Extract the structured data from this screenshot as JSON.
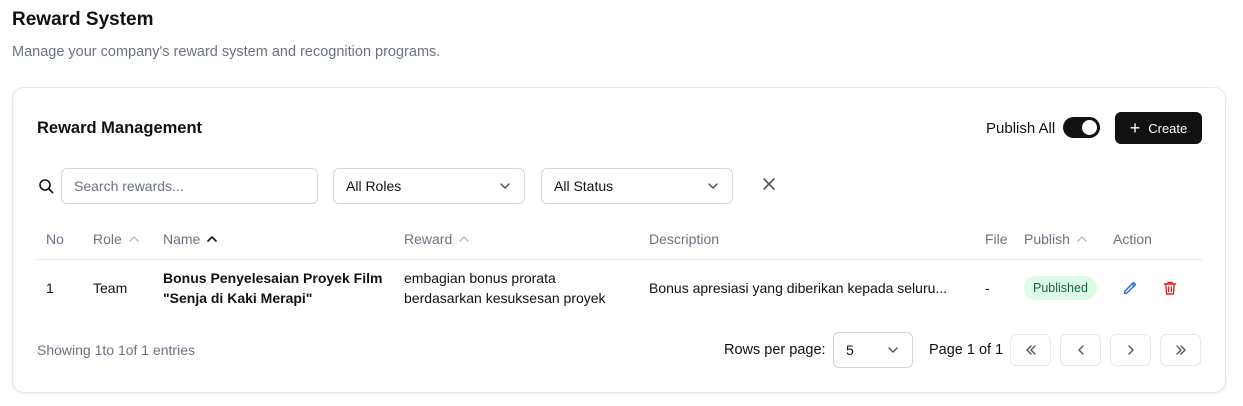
{
  "page": {
    "title": "Reward System",
    "subtitle": "Manage your company's reward system and recognition programs."
  },
  "card": {
    "title": "Reward Management",
    "publish_all_label": "Publish All",
    "publish_all_on": true,
    "create_label": "Create"
  },
  "filters": {
    "search_placeholder": "Search rewards...",
    "search_value": "",
    "role_selected": "All Roles",
    "status_selected": "All Status"
  },
  "table": {
    "columns": {
      "no": "No",
      "role": "Role",
      "name": "Name",
      "reward": "Reward",
      "description": "Description",
      "file": "File",
      "publish": "Publish",
      "action": "Action"
    },
    "rows": [
      {
        "no": "1",
        "role": "Team",
        "name_line1": "Bonus Penyelesaian Proyek Film",
        "name_line2": "\"Senja di Kaki Merapi\"",
        "reward_line1": "embagian bonus prorata",
        "reward_line2": "berdasarkan kesuksesan proyek",
        "description": "Bonus apresiasi yang diberikan kepada seluru...",
        "file": "-",
        "publish": "Published"
      }
    ]
  },
  "footer": {
    "showing": "Showing 1to 1of 1 entries",
    "rows_per_page_label": "Rows per page:",
    "rows_per_page_value": "5",
    "page_info": "Page 1 of 1"
  },
  "colors": {
    "primary": "#111111",
    "badge_bg": "#dcfce7",
    "badge_text": "#166534",
    "edit": "#2563eb",
    "delete": "#dc2626"
  }
}
